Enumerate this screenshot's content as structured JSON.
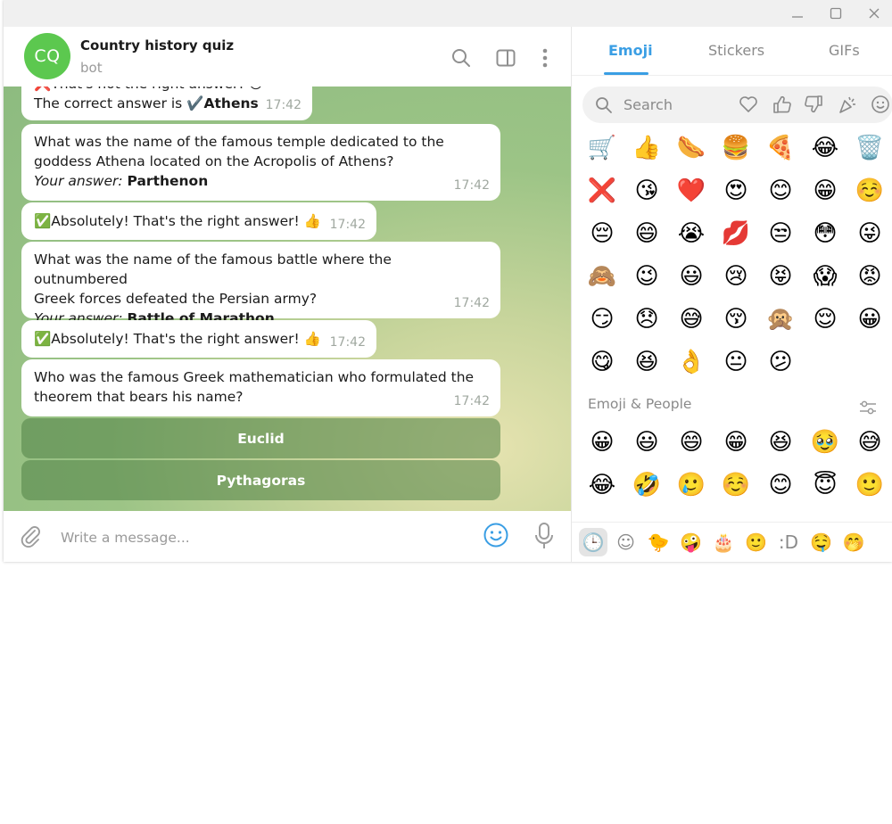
{
  "window": {
    "minimize": "—",
    "maximize": "☐",
    "close": "✕"
  },
  "chat": {
    "avatar_initials": "CQ",
    "title": "Country history quiz",
    "subtitle": "bot",
    "messages": [
      {
        "line1": "❌That's not the right answer! 😢",
        "line2_prefix": "The correct answer is ",
        "line2_check": "✔️",
        "line2_bold": "Athens",
        "time": "17:42"
      },
      {
        "line1": "What was the name of the famous temple dedicated to the",
        "line2": "goddess Athena located on the Acropolis of Athens?",
        "answer_label": "Your answer:",
        "answer_value": "Parthenon",
        "time": "17:42"
      },
      {
        "text": "✅Absolutely! That's the right answer! 👍",
        "time": "17:42"
      },
      {
        "line1": "What was the name of the famous battle where the outnumbered",
        "line2": "Greek forces defeated the Persian army?",
        "answer_label": "Your answer:",
        "answer_value": "Battle of Marathon",
        "time": "17:42"
      },
      {
        "text": "✅Absolutely! That's the right answer! 👍",
        "time": "17:42"
      },
      {
        "line1": "Who was the famous Greek mathematician who formulated the",
        "line2": "theorem that bears his name?",
        "time": "17:42"
      }
    ],
    "keyboard": [
      "Euclid",
      "Pythagoras"
    ],
    "composer": {
      "placeholder": "Write a message..."
    }
  },
  "panel": {
    "tabs": [
      "Emoji",
      "Stickers",
      "GIFs"
    ],
    "active_tab": "Emoji",
    "search_placeholder": "Search",
    "recent": [
      "🛒",
      "👍",
      "🌭",
      "🍔",
      "🍕",
      "😂",
      "🗑️",
      "❌",
      "😘",
      "❤️",
      "😍",
      "😊",
      "😁",
      "☺️",
      "😔",
      "😄",
      "😭",
      "💋",
      "😒",
      "😳",
      "😜",
      "🙈",
      "😉",
      "😃",
      "😢",
      "😝",
      "😱",
      "😡",
      "😏",
      "😞",
      "😅",
      "😚",
      "🙊",
      "😌",
      "😀",
      "😋",
      "😆",
      "👌",
      "😐",
      "😕"
    ],
    "section_title": "Emoji & People",
    "people": [
      "😀",
      "😃",
      "😄",
      "😁",
      "😆",
      "🥹",
      "😅",
      "😂",
      "🤣",
      "🥲",
      "☺️",
      "😊",
      "😇",
      "🙂"
    ],
    "category_bar": [
      "🕒",
      "☺",
      "🐤",
      "🤪",
      "🎂",
      "🙂",
      ":D",
      "🤤",
      "🤭"
    ]
  }
}
